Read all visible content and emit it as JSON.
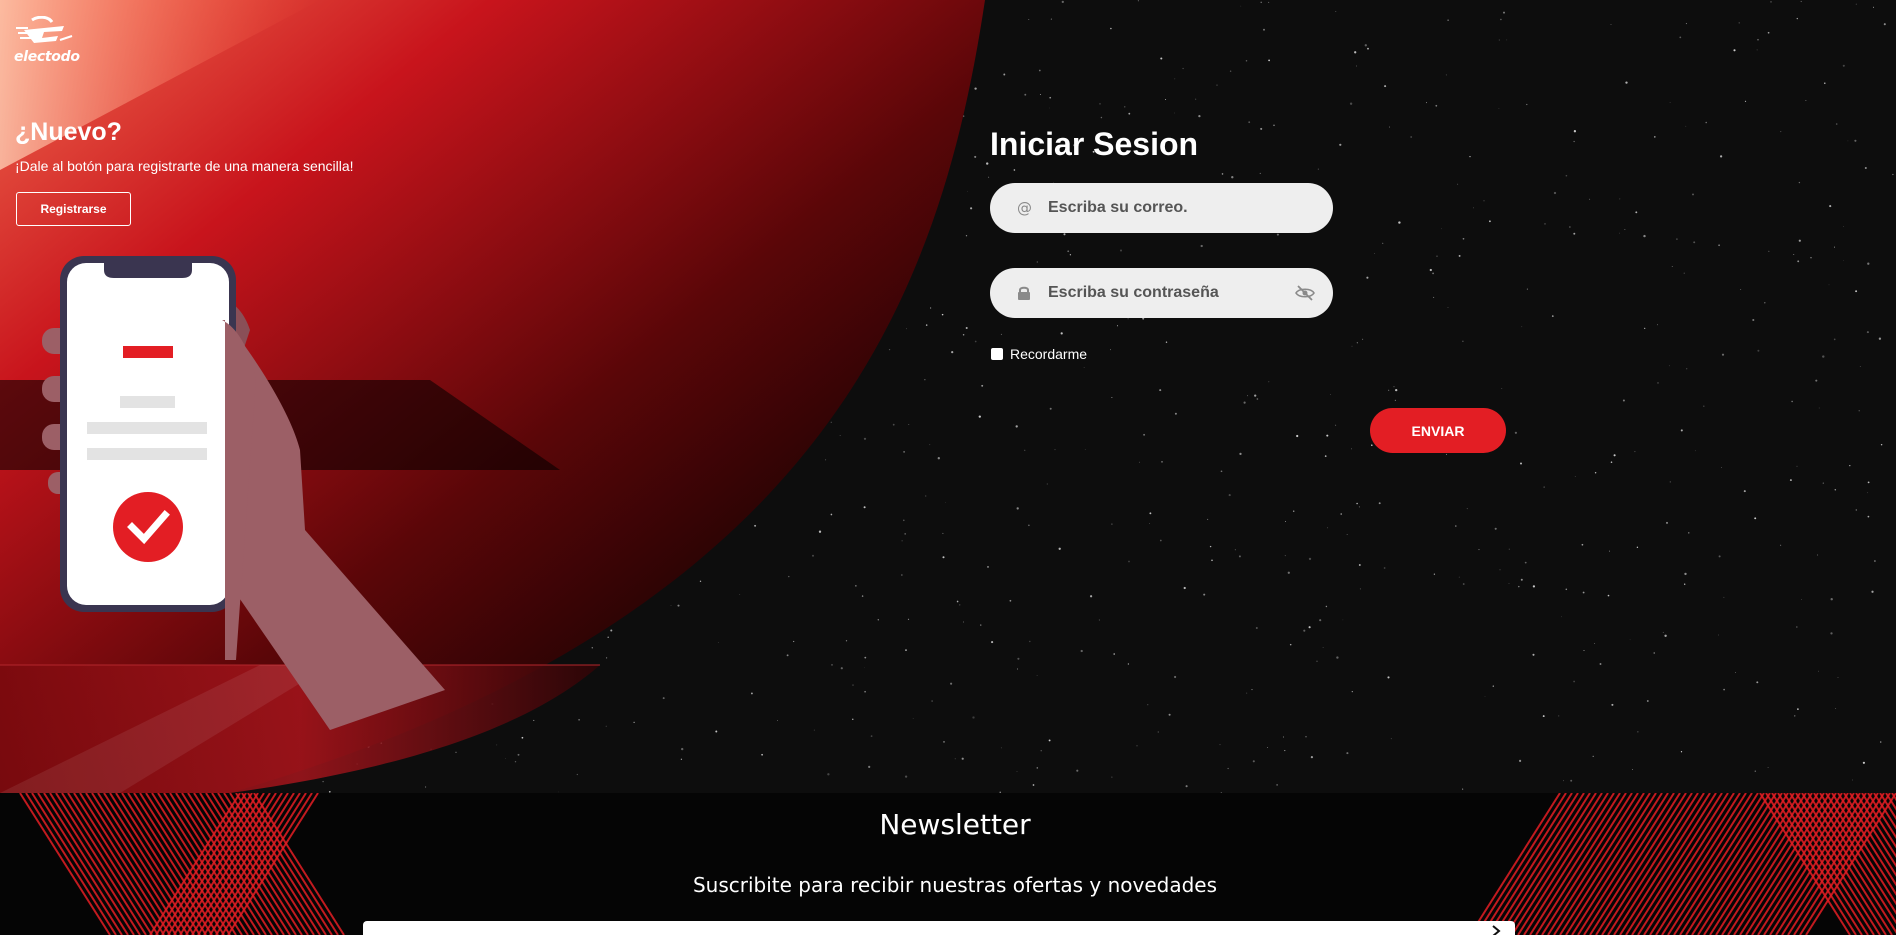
{
  "brand": {
    "name": "electodo"
  },
  "register_panel": {
    "title": "¿Nuevo?",
    "text": "¡Dale al botón para registrarte de una manera sencilla!",
    "button_label": "Registrarse"
  },
  "login": {
    "title": "Iniciar Sesion",
    "email_placeholder": "Escriba su correo.",
    "password_placeholder": "Escriba su contraseña",
    "email_icon": "at-sign-icon",
    "password_icon": "lock-icon",
    "password_toggle_icon": "eye-slash-icon",
    "remember_label": "Recordarme",
    "remember_checked": false,
    "submit_label": "ENVIAR"
  },
  "newsletter": {
    "title": "Newsletter",
    "subtitle": "Suscribite para recibir nuestras ofertas y novedades",
    "submit_icon": "chevron-right-icon"
  },
  "colors": {
    "accent": "#e31e24",
    "background": "#0d0d0d",
    "field_bg": "#eeeeee"
  }
}
